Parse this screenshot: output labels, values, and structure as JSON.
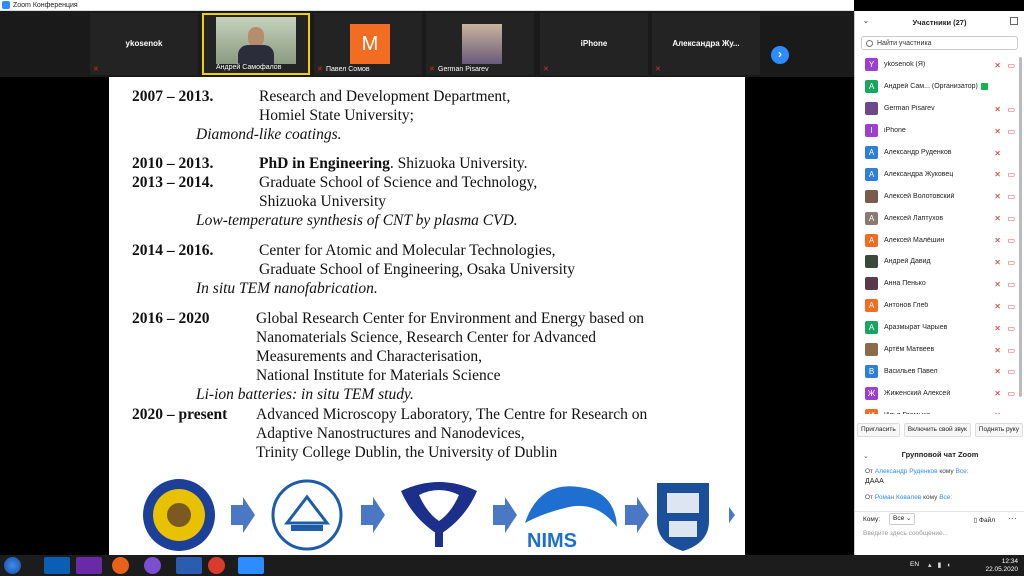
{
  "window": {
    "title": "Zoom Конференция"
  },
  "gallery": {
    "tiles": [
      {
        "name": "ykosenok",
        "caption": ""
      },
      {
        "name": "",
        "caption": "Андрей Самофалов"
      },
      {
        "name": "",
        "caption": "Павел Сомов",
        "avatar_letter": "M"
      },
      {
        "name": "",
        "caption": "German Pisarev"
      },
      {
        "name": "iPhone",
        "caption": ""
      },
      {
        "name": "Александра Жу...",
        "caption": ""
      }
    ]
  },
  "slide": {
    "entries": [
      {
        "years": "2007 – 2013.",
        "lines": [
          "Research and Development Department,",
          "Homiel State University;"
        ],
        "note": "Diamond-like coatings."
      },
      {
        "years": "2010 – 2013.",
        "bold": "PhD in Engineering",
        "rest": ". Shizuoka University."
      },
      {
        "years": "2013 – 2014.",
        "lines": [
          "Graduate School of Science and Technology,",
          "Shizuoka University"
        ],
        "note": "Low-temperature synthesis of CNT by plasma CVD."
      },
      {
        "years": "2014 – 2016.",
        "lines": [
          "Center for Atomic and Molecular Technologies,",
          "Graduate School of Engineering, Osaka University"
        ],
        "note": "In situ TEM nanofabrication."
      },
      {
        "years": "2016 – 2020",
        "lines": [
          "Global Research Center for Environment and Energy based on",
          "Nanomaterials Science, Research Center for Advanced",
          "Measurements and Characterisation,",
          "National Institute for Materials Science"
        ],
        "note": "Li-ion batteries: in situ TEM study."
      },
      {
        "years": "2020 – present",
        "lines": [
          "Advanced Microscopy Laboratory, The Centre for Research on",
          "Adaptive Nanostructures and Nanodevices,",
          "Trinity College Dublin, the University of Dublin"
        ]
      }
    ],
    "logos": {
      "nims": "NIMS"
    }
  },
  "participants": {
    "header": "Участники (27)",
    "search_placeholder": "Найти участника",
    "list": [
      {
        "letter": "Y",
        "color": "#9b3fd0",
        "name": "ykosenok (Я)",
        "mic": true,
        "cam": true
      },
      {
        "letter": "A",
        "color": "#17a560",
        "name": "Андрей Сам... (Организатор)",
        "host": true
      },
      {
        "letter": "",
        "color": "#6c4a8a",
        "name": "German Pisarev",
        "mic": true,
        "cam": true
      },
      {
        "letter": "I",
        "color": "#9b3fd0",
        "name": "iPhone",
        "mic": true,
        "cam": true
      },
      {
        "letter": "A",
        "color": "#2f7fd6",
        "name": "Александр Руденков",
        "mic": true
      },
      {
        "letter": "A",
        "color": "#2f7fd6",
        "name": "Александра Жуковец",
        "mic": true,
        "cam": true
      },
      {
        "letter": "",
        "color": "#7a5a4a",
        "name": "Алексей Волотовский",
        "mic": true,
        "cam": true
      },
      {
        "letter": "A",
        "color": "#8a7a70",
        "name": "Алексей Лаптухов",
        "mic": true,
        "cam": true
      },
      {
        "letter": "A",
        "color": "#f26d21",
        "name": "Алексей Малёшин",
        "mic": true,
        "cam": true
      },
      {
        "letter": "",
        "color": "#3a4a3a",
        "name": "Андрей Давид",
        "mic": true,
        "cam": true
      },
      {
        "letter": "",
        "color": "#5a3a4a",
        "name": "Анна Пенько",
        "mic": true,
        "cam": true
      },
      {
        "letter": "A",
        "color": "#f26d21",
        "name": "Антонов Глеб",
        "mic": true,
        "cam": true
      },
      {
        "letter": "A",
        "color": "#17a560",
        "name": "Аразмырат Чарыев",
        "mic": true,
        "cam": true
      },
      {
        "letter": "",
        "color": "#8a6a4a",
        "name": "Артём Матвеев",
        "mic": true,
        "cam": true
      },
      {
        "letter": "B",
        "color": "#2f7fd6",
        "name": "Васильев Павел",
        "mic": true,
        "cam": true
      },
      {
        "letter": "Ж",
        "color": "#9b3fd0",
        "name": "Жиженский Алексей",
        "mic": true,
        "cam": true
      },
      {
        "letter": "И",
        "color": "#f26d21",
        "name": "Илья Громыко",
        "mic": true,
        "cam": true
      }
    ],
    "actions": [
      "Пригласить",
      "Включить свой звук",
      "Поднять руку"
    ]
  },
  "chat": {
    "header": "Групповой чат Zoom",
    "messages": [
      {
        "prefix": "От",
        "from": "Александр Руденков",
        "mid": "кому",
        "to": "Все:",
        "text": "ДААА"
      },
      {
        "prefix": "От",
        "from": "Роман Ковалев",
        "mid": "кому",
        "to": "Все:",
        "text": ""
      }
    ],
    "to_label": "Кому:",
    "to_value": "Все",
    "file_label": "Файл",
    "input_placeholder": "Введите здесь сообщение..."
  },
  "taskbar": {
    "lang": "EN",
    "time": "12:34",
    "date": "22.05.2020"
  },
  "colors": {
    "accent": "#2D8CFF",
    "muted": "#e02828"
  }
}
